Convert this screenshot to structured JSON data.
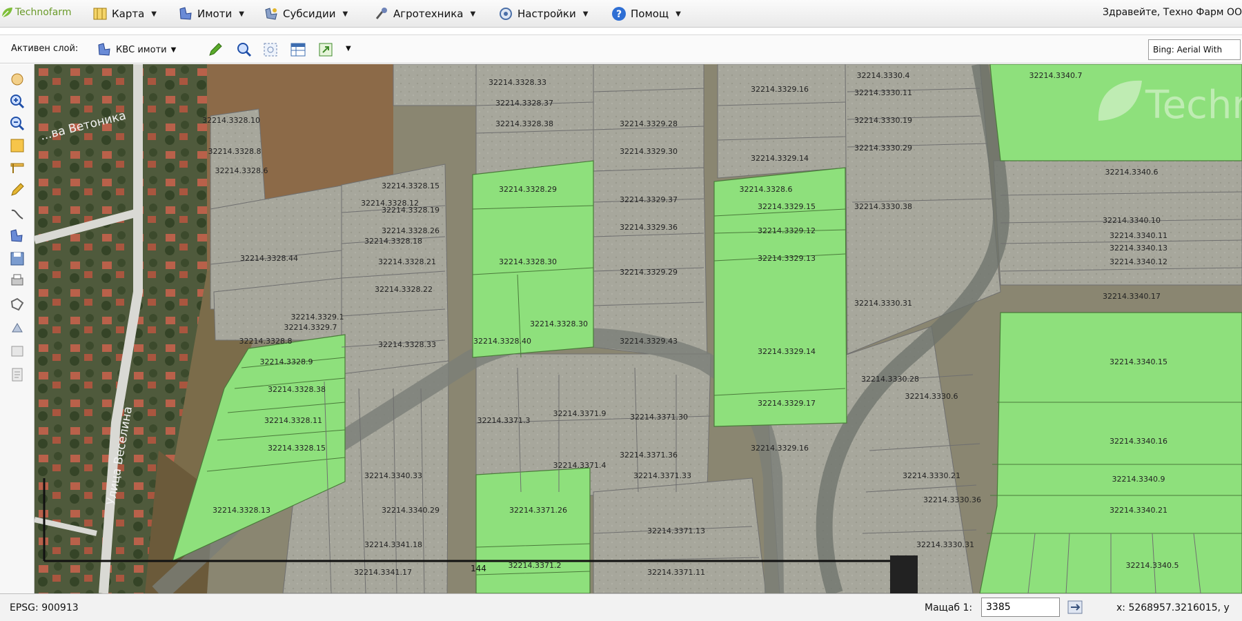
{
  "app": {
    "logo_text": "Technofarm"
  },
  "menu": {
    "items": [
      {
        "label": "Карта",
        "icon": "map-icon"
      },
      {
        "label": "Имоти",
        "icon": "plots-icon"
      },
      {
        "label": "Субсидии",
        "icon": "subsidies-icon"
      },
      {
        "label": "Агротехника",
        "icon": "agrotech-icon"
      },
      {
        "label": "Настройки",
        "icon": "settings-icon"
      },
      {
        "label": "Помощ",
        "icon": "help-icon"
      }
    ],
    "greeting": "Здравейте, Техно Фарм ОО"
  },
  "toolbar": {
    "active_layer_label": "Активен слой:",
    "active_layer_value": "КВС имоти",
    "basemap_value": "Bing: Aerial With"
  },
  "map": {
    "watermark": "Techno",
    "street_labels": [
      "...ва Ветоника",
      "Улица Веселина"
    ],
    "scale_label": "144",
    "colors": {
      "selected_parcel": "#8ee07c",
      "parcel": "#a6a69a",
      "parcel_outline": "#6f6f6f"
    },
    "parcels": [
      "32214.3328.10",
      "32214.3328.8",
      "32214.3328.6",
      "32214.3328.12",
      "32214.3328.18",
      "32214.3328.44",
      "32214.3329.1",
      "32214.3329.7",
      "32214.3328.8",
      "32214.3328.9",
      "32214.3328.38",
      "32214.3328.11",
      "32214.3328.15",
      "32214.3328.13",
      "32214.3328.15",
      "32214.3328.19",
      "32214.3328.26",
      "32214.3328.21",
      "32214.3328.22",
      "32214.3328.33",
      "32214.3340.33",
      "32214.3340.29",
      "32214.3341.18",
      "32214.3341.17",
      "32214.3328.33",
      "32214.3328.37",
      "32214.3328.38",
      "32214.3328.29",
      "32214.3328.30",
      "32214.3328.40",
      "32214.3328.30",
      "32214.3371.3",
      "32214.3371.9",
      "32214.3371.4",
      "32214.3371.26",
      "32214.3371.2",
      "32214.3329.28",
      "32214.3329.30",
      "32214.3329.37",
      "32214.3329.36",
      "32214.3329.29",
      "32214.3329.43",
      "32214.3371.30",
      "32214.3371.36",
      "32214.3371.33",
      "32214.3371.13",
      "32214.3371.11",
      "32214.3328.6",
      "32214.3329.16",
      "32214.3329.14",
      "32214.3329.15",
      "32214.3329.12",
      "32214.3329.13",
      "32214.3329.14",
      "32214.3329.17",
      "32214.3329.16",
      "32214.3330.4",
      "32214.3330.11",
      "32214.3330.19",
      "32214.3330.29",
      "32214.3330.38",
      "32214.3330.31",
      "32214.3330.28",
      "32214.3330.6",
      "32214.3330.21",
      "32214.3330.36",
      "32214.3330.31",
      "32214.3340.7",
      "32214.3340.6",
      "32214.3340.10",
      "32214.3340.11",
      "32214.3340.13",
      "32214.3340.12",
      "32214.3340.17",
      "32214.3340.15",
      "32214.3340.16",
      "32214.3340.9",
      "32214.3340.21",
      "32214.3340.5"
    ]
  },
  "status": {
    "epsg": "EPSG: 900913",
    "scale_label": "Мащаб 1:",
    "scale_value": "3385",
    "coords": "x: 5268957.3216015, y"
  }
}
